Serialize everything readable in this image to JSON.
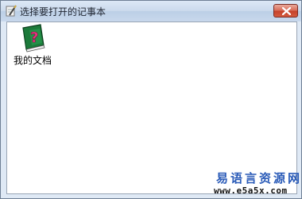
{
  "window": {
    "title": "选择要打开的记事本",
    "icon": "notepad-pencil-icon",
    "close_icon": "close-x-icon"
  },
  "items": [
    {
      "label": "我的文档",
      "icon": "green-book-question-icon"
    }
  ],
  "watermark": {
    "title": "易语言资源网",
    "url": "www.e5a5x.com"
  },
  "colors": {
    "titlebar": "#c8d8ec",
    "close_button": "#c6432b",
    "watermark_title": "#2a5bb8"
  }
}
